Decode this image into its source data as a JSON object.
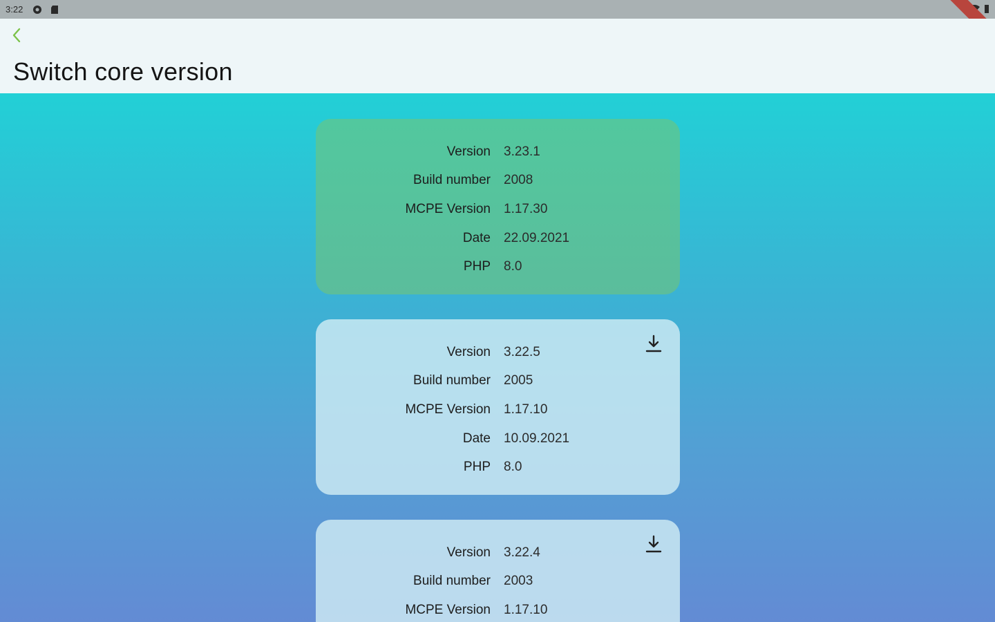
{
  "status_bar": {
    "time": "3:22"
  },
  "app_bar": {
    "title": "Switch core version"
  },
  "cards": [
    {
      "active": true,
      "rows": [
        {
          "label": "Version",
          "value": "3.23.1"
        },
        {
          "label": "Build number",
          "value": "2008"
        },
        {
          "label": "MCPE Version",
          "value": "1.17.30"
        },
        {
          "label": "Date",
          "value": "22.09.2021"
        },
        {
          "label": "PHP",
          "value": "8.0"
        }
      ]
    },
    {
      "active": false,
      "rows": [
        {
          "label": "Version",
          "value": "3.22.5"
        },
        {
          "label": "Build number",
          "value": "2005"
        },
        {
          "label": "MCPE Version",
          "value": "1.17.10"
        },
        {
          "label": "Date",
          "value": "10.09.2021"
        },
        {
          "label": "PHP",
          "value": "8.0"
        }
      ]
    },
    {
      "active": false,
      "rows": [
        {
          "label": "Version",
          "value": "3.22.4"
        },
        {
          "label": "Build number",
          "value": "2003"
        },
        {
          "label": "MCPE Version",
          "value": "1.17.10"
        }
      ]
    }
  ],
  "colors": {
    "accent": "#7cc24a",
    "active_card": "#55c49d",
    "inactive_card": "#cfe8f3"
  },
  "icons": {
    "back": "chevron-left-icon",
    "download": "download-icon"
  }
}
